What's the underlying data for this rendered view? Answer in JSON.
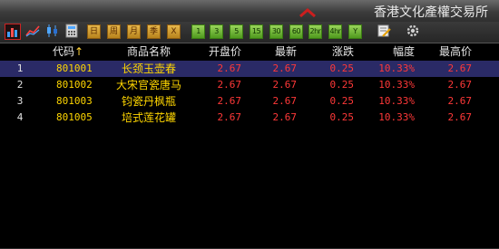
{
  "window": {
    "title": "香港文化產權交易所"
  },
  "toolbar": {
    "icons": [
      "bar-chart-icon",
      "line-chart-icon",
      "candlestick-icon",
      "calculator-icon"
    ],
    "period_buttons": [
      "日",
      "周",
      "月",
      "季",
      "X"
    ],
    "minute_buttons": [
      "1",
      "3",
      "5",
      "15",
      "30",
      "60",
      "2hr",
      "4hr",
      "Y"
    ],
    "trailing_icons": [
      "edit-icon",
      "settings-icon"
    ]
  },
  "table": {
    "columns": {
      "code": "代码",
      "sort_indicator": "↑",
      "name": "商品名称",
      "open": "开盘价",
      "last": "最新",
      "change": "涨跌",
      "amplitude": "幅度",
      "high": "最高价"
    },
    "rows": [
      {
        "idx": "1",
        "code": "801001",
        "name": "长颈玉壶春",
        "open": "2.67",
        "last": "2.67",
        "change": "0.25",
        "amplitude": "10.33%",
        "high": "2.67"
      },
      {
        "idx": "2",
        "code": "801002",
        "name": "大宋官瓷唐马",
        "open": "2.67",
        "last": "2.67",
        "change": "0.25",
        "amplitude": "10.33%",
        "high": "2.67"
      },
      {
        "idx": "3",
        "code": "801003",
        "name": "钧瓷丹枫瓶",
        "open": "2.67",
        "last": "2.67",
        "change": "0.25",
        "amplitude": "10.33%",
        "high": "2.67"
      },
      {
        "idx": "4",
        "code": "801005",
        "name": "培式莲花罐",
        "open": "2.67",
        "last": "2.67",
        "change": "0.25",
        "amplitude": "10.33%",
        "high": "2.67"
      }
    ],
    "selected_row": "1"
  },
  "colors": {
    "background": "#000000",
    "selected_row": "#2a2a66",
    "code_name_text": "#ffd600",
    "price_text": "#ff3838"
  }
}
